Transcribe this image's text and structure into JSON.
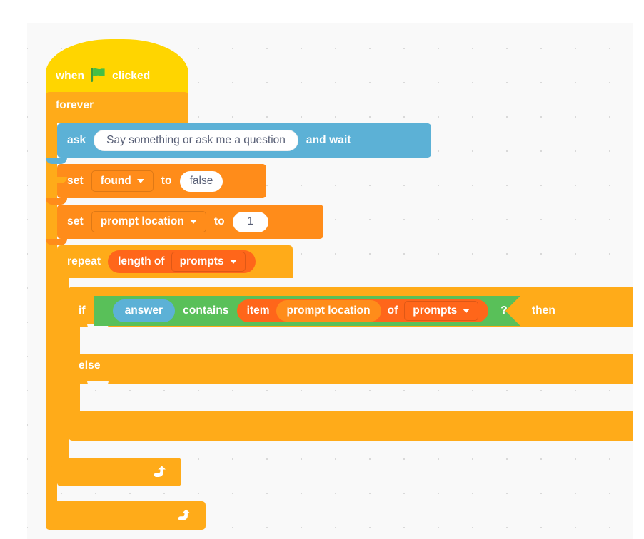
{
  "app": {
    "name": "Scratch Block Editor",
    "canvas_background": "#f9f9f9"
  },
  "colors": {
    "events": "#FFD500",
    "control": "#FFAB19",
    "sensing": "#5CB1D6",
    "variables": "#FF8C1A",
    "lists": "#FF661A",
    "operators": "#59C059",
    "input_text": "#575E75",
    "block_text": "#FFFFFF"
  },
  "script": {
    "hat": {
      "word_when": "when",
      "icon": "green-flag-icon",
      "word_clicked": "clicked"
    },
    "forever": {
      "label": "forever",
      "loop_icon": "loop-arrow-icon"
    },
    "ask": {
      "word_ask": "ask",
      "question_value": "Say something or ask me a question",
      "question_placeholder": "Say something or ask me a question",
      "word_and_wait": "and wait"
    },
    "set_found": {
      "word_set": "set",
      "variable": "found",
      "word_to": "to",
      "value": "false"
    },
    "set_prompt_location": {
      "word_set": "set",
      "variable": "prompt location",
      "word_to": "to",
      "value": "1"
    },
    "repeat": {
      "word_repeat": "repeat",
      "length_of": "length of",
      "list_name": "prompts",
      "loop_icon": "loop-arrow-icon"
    },
    "if_else": {
      "word_if": "if",
      "word_then": "then",
      "word_else": "else",
      "condition": {
        "left_operand": "answer",
        "operator": "contains",
        "right_operand": {
          "word_item": "item",
          "index_variable": "prompt location",
          "word_of": "of",
          "list_name": "prompts"
        },
        "question_mark": "?"
      },
      "if_body": "",
      "else_body": ""
    }
  }
}
